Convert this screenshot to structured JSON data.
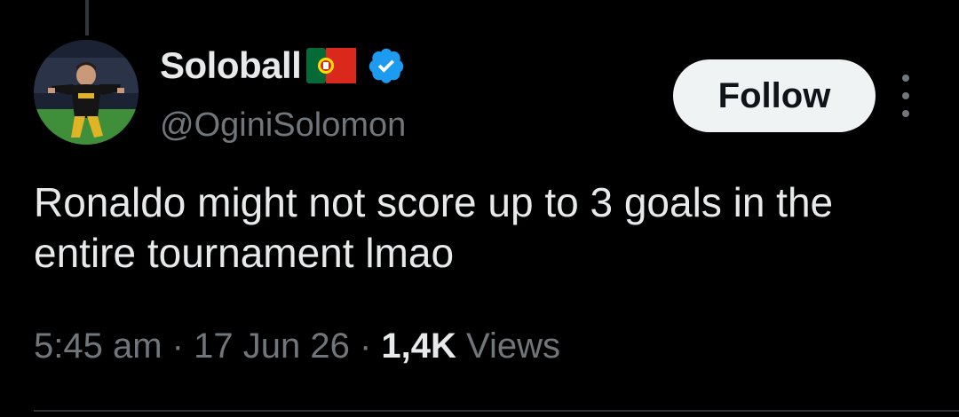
{
  "author": {
    "display_name": "Soloball",
    "handle": "@OginiSolomon",
    "flag_icon": "portugal-flag-icon",
    "verified_icon": "verified-badge-icon",
    "verified_color": "#1d9bf0"
  },
  "actions": {
    "follow_label": "Follow",
    "more_icon": "more-vertical-icon"
  },
  "tweet": {
    "text": "Ronaldo might not score up to 3 goals in the entire tournament lmao"
  },
  "meta": {
    "time": "5:45 am",
    "separator": "·",
    "date": "17 Jun 26",
    "views_count": "1,4K",
    "views_label": "Views"
  },
  "colors": {
    "background": "#000000",
    "primary_text": "#e7e9ea",
    "secondary_text": "#71767b",
    "follow_bg": "#eff3f4",
    "follow_text": "#0f1419"
  }
}
